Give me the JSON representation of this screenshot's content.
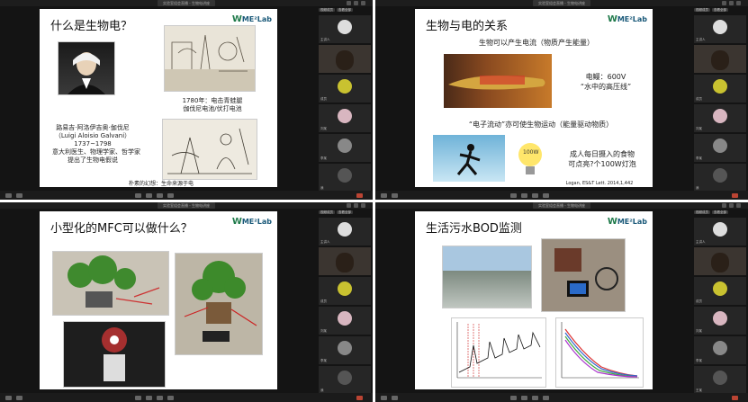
{
  "window_title": "实验室组会直播 - 生物电讲座",
  "quads": {
    "q1": {
      "slide_title": "什么是生物电？",
      "logo": {
        "mark": "W",
        "text": "ME²Lab"
      },
      "portrait_caption": [
        "路易吉·阿洛伊吉奥·伽伐尼",
        "（Luigi Aloisio Galvani）",
        "1737~1798",
        "意大利医生、物理学家、哲学家",
        "提出了生物电假说"
      ],
      "exp_caption": [
        "1780年：电击青蛙腿",
        "伽伐尼电池/伏打电池"
      ],
      "footer": "朴素的幻想：生命来源于电"
    },
    "q2": {
      "slide_title": "生物与电的关系",
      "subtitle": "生物可以产生电流（物质产生能量）",
      "eel_label": [
        "电鳗：600V",
        "“水中的高压线”"
      ],
      "middle_text": "“电子流动”亦可使生物运动（能量驱动物质）",
      "bulb_label": "100W",
      "food_text": [
        "成人每日摄入的食物",
        "可点亮?个100W灯泡"
      ],
      "citation": "Logan, ES&T Lett. 2014,1,442"
    },
    "q3": {
      "slide_title": "小型化的MFC可以做什么？"
    },
    "q4": {
      "slide_title": "生活污水BOD监测"
    },
    "participants": {
      "header_label": "视频成员",
      "header_btn": "查看全部",
      "names": [
        "主讲人",
        "成员",
        "刘某",
        "李某",
        "我",
        "王某"
      ]
    },
    "controls": {
      "mic": "静音",
      "cam": "视频",
      "share": "共享"
    },
    "colors": {
      "bg": "#141414",
      "accent": "#1f7a4a"
    }
  }
}
